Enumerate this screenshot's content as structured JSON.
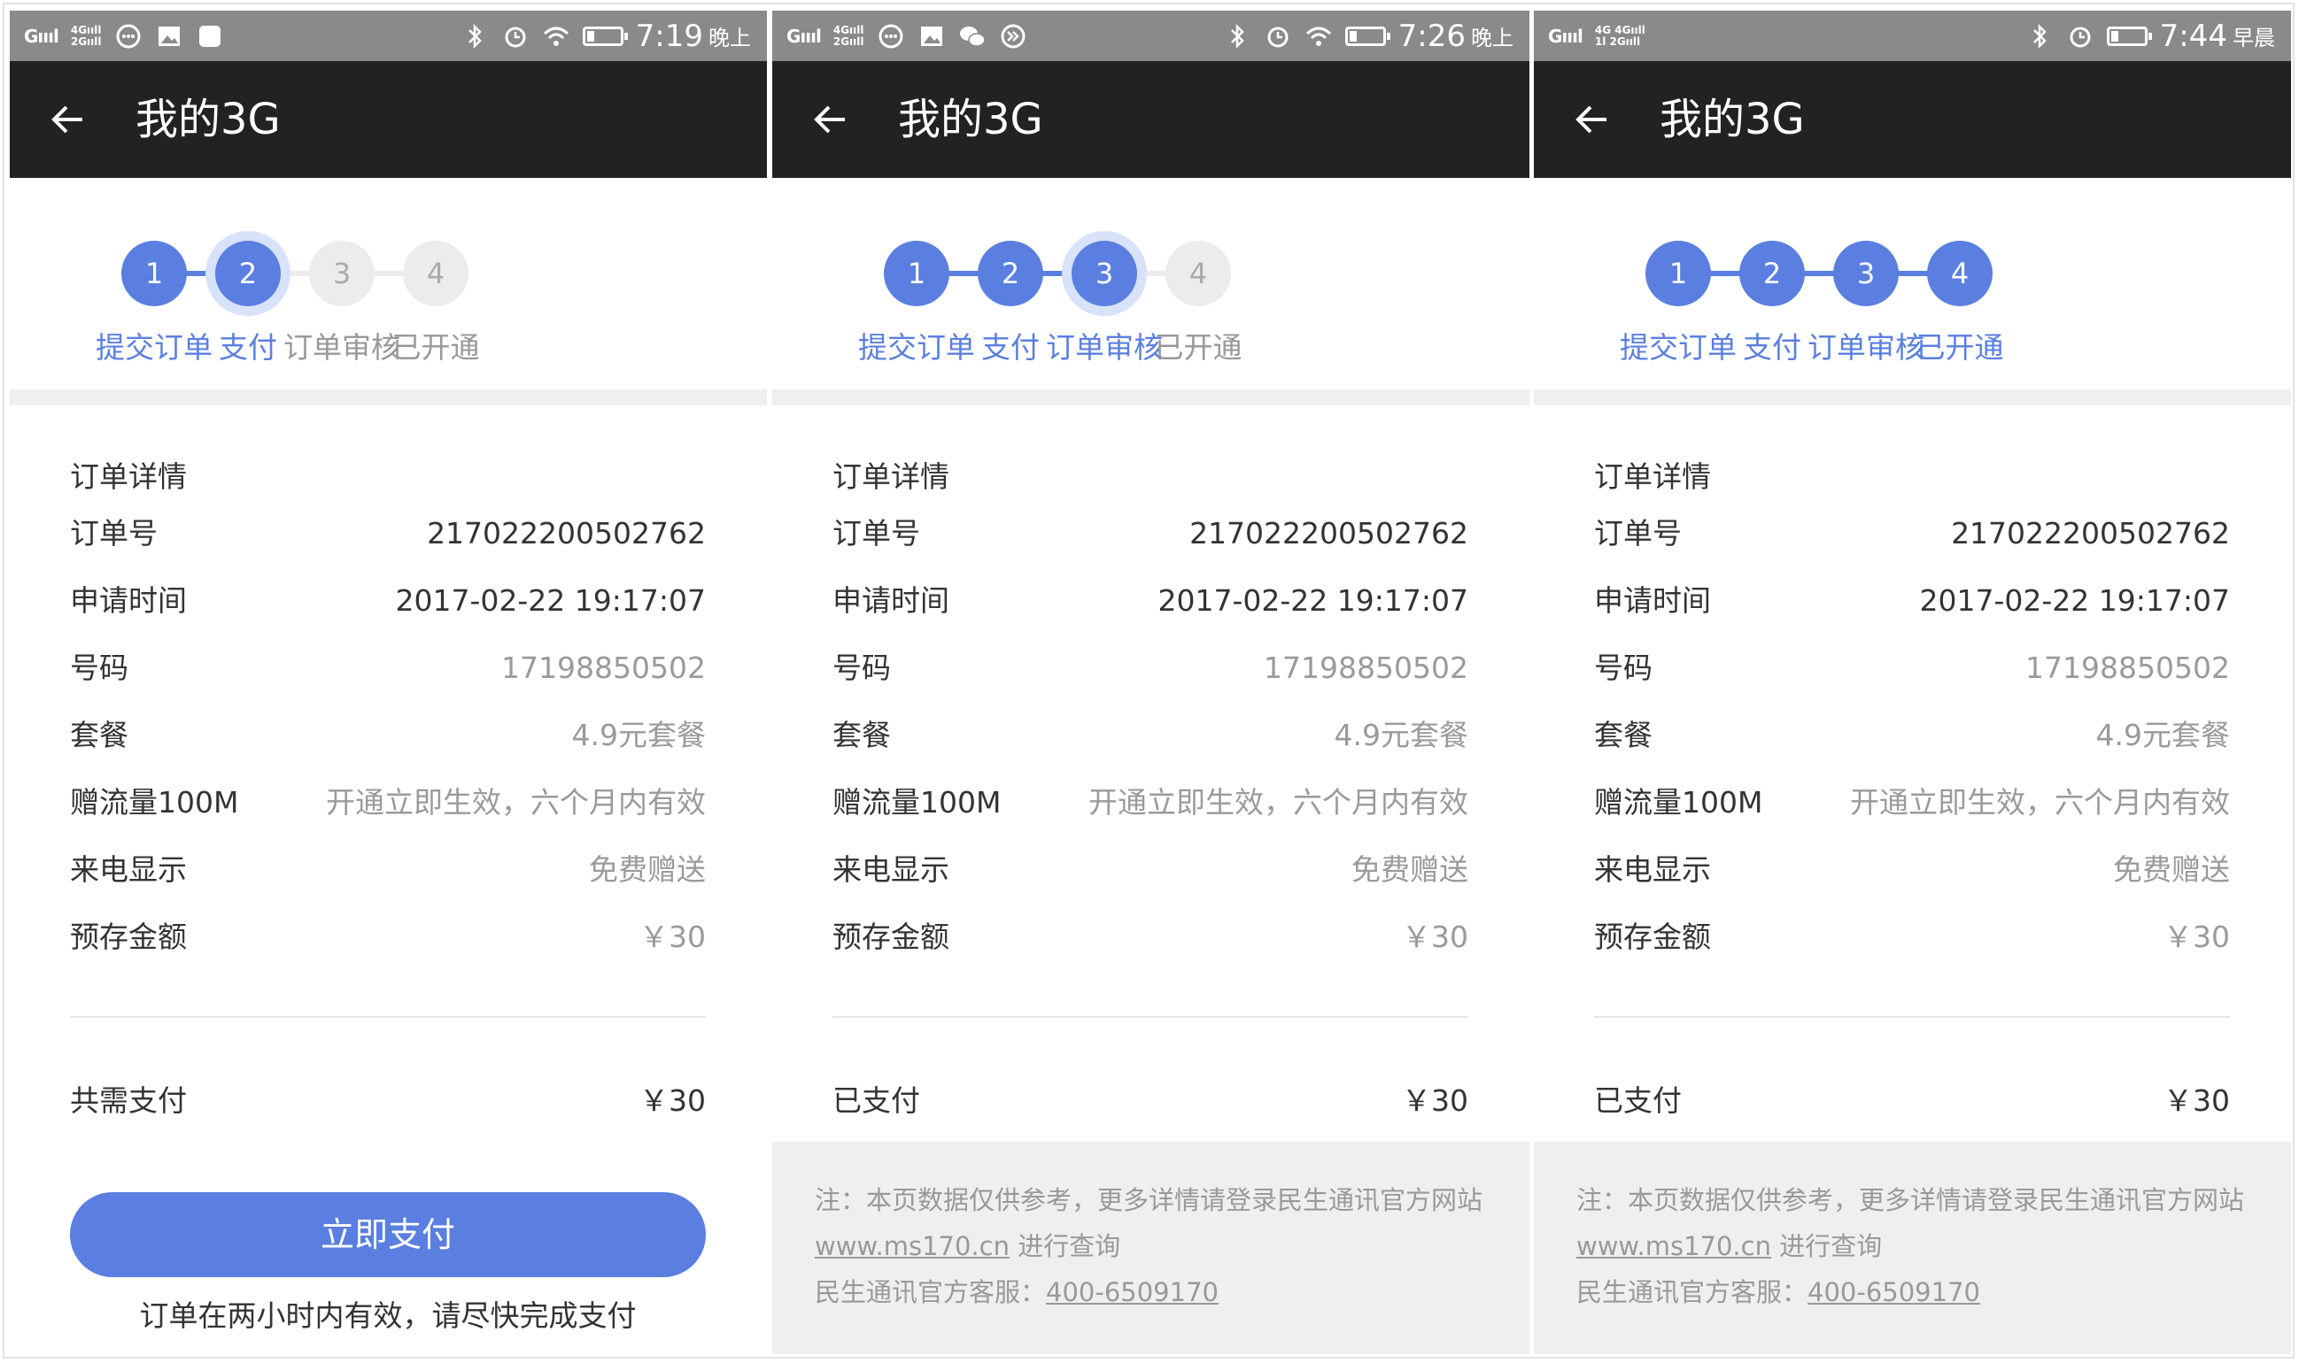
{
  "title": "我的3G",
  "step_labels": [
    "提交订单",
    "支付",
    "订单审核",
    "已开通"
  ],
  "details_title": "订单详情",
  "rows": [
    {
      "label": "订单号",
      "value": "217022200502762",
      "tone": "dark"
    },
    {
      "label": "申请时间",
      "value": "2017-02-22 19:17:07",
      "tone": "dark"
    },
    {
      "label": "号码",
      "value": "17198850502",
      "tone": "grey"
    },
    {
      "label": "套餐",
      "value": "4.9元套餐",
      "tone": "grey"
    },
    {
      "label": "赠流量100M",
      "value": "开通立即生效，六个月内有效",
      "tone": "grey"
    },
    {
      "label": "来电显示",
      "value": "免费赠送",
      "tone": "grey"
    },
    {
      "label": "预存金额",
      "value": "￥30",
      "tone": "grey"
    }
  ],
  "colors": {
    "accent": "#5b7fe0",
    "toolbar": "#222222",
    "statusbar": "#8a8a8a"
  },
  "screens": [
    {
      "status": {
        "signal": "Gıııl",
        "network": [
          "4Gııll",
          "2Gııll"
        ],
        "time": "7:19",
        "ampm": "晚上",
        "icons": [
          "chat-bubble-icon",
          "image-icon",
          "app-square-icon"
        ]
      },
      "active_steps": 2,
      "current_step": 2,
      "total_label": "共需支付",
      "total_value": "￥30",
      "pay_button": "立即支付",
      "pay_note": "订单在两小时内有效，请尽快完成支付"
    },
    {
      "status": {
        "signal": "Gıııl",
        "network": [
          "4Gııll",
          "2Gııll"
        ],
        "time": "7:26",
        "ampm": "晚上",
        "icons": [
          "chat-bubble-icon",
          "image-icon",
          "wechat-icon",
          "forward-circle-icon"
        ]
      },
      "active_steps": 3,
      "current_step": 3,
      "total_label": "已支付",
      "total_value": "￥30"
    },
    {
      "status": {
        "signal": "Gıııl",
        "network": [
          "4G 4Gııll",
          "1l 2Gııll"
        ],
        "time": "7:44",
        "ampm": "早晨",
        "icons": []
      },
      "active_steps": 4,
      "current_step": 0,
      "total_label": "已支付",
      "total_value": "￥30"
    }
  ],
  "notice": {
    "line1": "注：本页数据仅供参考，更多详情请登录民生通讯官方网站",
    "link": "www.ms170.cn",
    "line2_suffix": " 进行查询",
    "phone_label": "民生通讯官方客服：",
    "phone": "400-6509170"
  }
}
